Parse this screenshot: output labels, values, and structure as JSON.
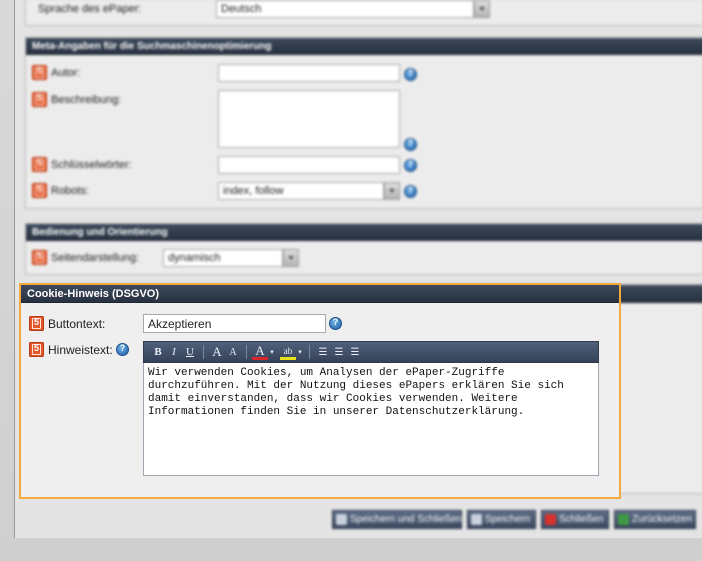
{
  "top_row": {
    "label": "Sprache des ePaper:",
    "value": "Deutsch"
  },
  "meta_section": {
    "title": "Meta-Angaben für die Suchmaschinenoptimierung",
    "author_label": "Autor:",
    "description_label": "Beschreibung:",
    "keywords_label": "Schlüsselwörter:",
    "robots_label": "Robots:",
    "robots_value": "index, follow"
  },
  "nav_section": {
    "title": "Bedienung und Orientierung",
    "page_display_label": "Seitendarstellung:",
    "page_display_value": "dynamisch"
  },
  "cookie_section": {
    "title": "Cookie-Hinweis (DSGVO)",
    "button_text_label": "Buttontext:",
    "button_text_value": "Akzeptieren",
    "notice_label": "Hinweistext:",
    "notice_value": "Wir verwenden Cookies, um Analysen der ePaper-Zugriffe durchzuführen. Mit der Nutzung dieses ePapers erklären Sie sich damit einverstanden, dass wir Cookies verwenden. Weitere Informationen finden Sie in unserer Datenschutzerklärung."
  },
  "toolbar": {
    "bold": "B",
    "italic": "I",
    "underline": "U",
    "grow": "A",
    "shrink": "A",
    "font_color": "A",
    "highlight": "ab"
  },
  "buttons": {
    "save_close": "Speichern und Schließen",
    "save": "Speichern",
    "close": "Schließen",
    "reset": "Zurücksetzen"
  }
}
